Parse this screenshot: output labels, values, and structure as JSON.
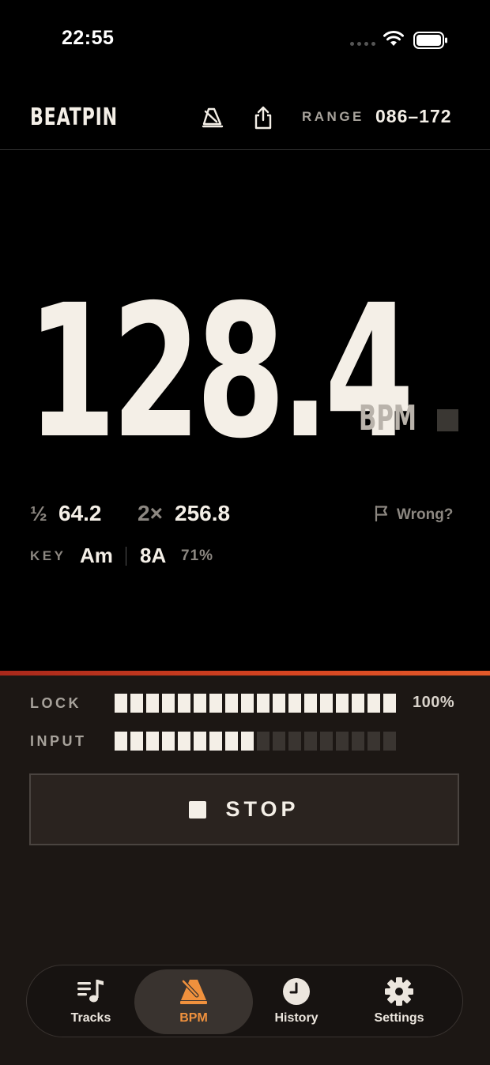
{
  "status_bar": {
    "time": "22:55"
  },
  "header": {
    "app_name": "BEATPIN",
    "metronome_icon": "metronome-icon",
    "share_icon": "share-icon",
    "range_label": "RANGE",
    "range_value": "086–172"
  },
  "tempo": {
    "bpm": "128.4",
    "unit": "BPM",
    "half_symbol": "½",
    "half_value": "64.2",
    "double_symbol": "2×",
    "double_value": "256.8",
    "wrong_label": "Wrong?"
  },
  "key": {
    "label": "KEY",
    "value": "Am",
    "camelot": "8A",
    "confidence": "71%"
  },
  "meters": {
    "lock_label": "LOCK",
    "lock_percent": "100%",
    "lock_level": 1.0,
    "input_label": "INPUT",
    "input_level": 0.5,
    "segments": 18
  },
  "stop_button": {
    "label": "STOP"
  },
  "tabs": [
    {
      "label": "Tracks",
      "icon": "music-list-icon",
      "active": false
    },
    {
      "label": "BPM",
      "icon": "metronome-icon",
      "active": true
    },
    {
      "label": "History",
      "icon": "clock-icon",
      "active": false
    },
    {
      "label": "Settings",
      "icon": "gear-icon",
      "active": false
    }
  ],
  "colors": {
    "background": "#000000",
    "panel": "#1c1714",
    "text": "#f4efe7",
    "muted": "#8c8781",
    "accent": "#f0913d",
    "accent_line": "#d64521"
  }
}
